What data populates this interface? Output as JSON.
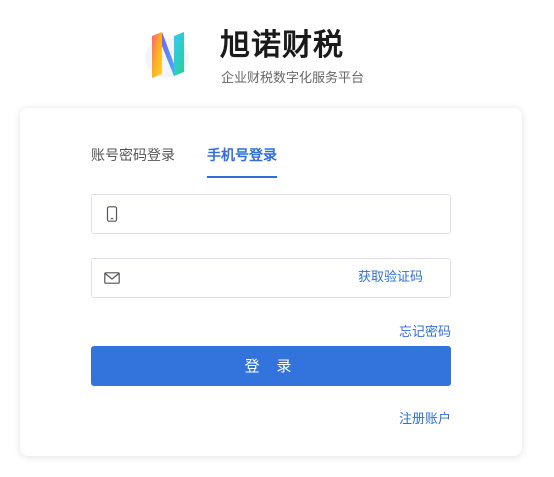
{
  "brand": {
    "name": "旭诺财税",
    "subtitle": "企业财税数字化服务平台"
  },
  "login": {
    "tabs": [
      {
        "label": "账号密码登录",
        "active": false
      },
      {
        "label": "手机号登录",
        "active": true
      }
    ],
    "phone_field": {
      "icon": "mobile-phone-icon",
      "value": "",
      "placeholder": ""
    },
    "code_field": {
      "icon": "envelope-icon",
      "value": "",
      "placeholder": "",
      "get_code_label": "获取验证码"
    },
    "forgot_password_label": "忘记密码",
    "submit_label": "登 录",
    "register_label": "注册账户"
  },
  "colors": {
    "accent": "#2f6fdb",
    "button": "#3273dc",
    "border": "#dcdfe6"
  }
}
